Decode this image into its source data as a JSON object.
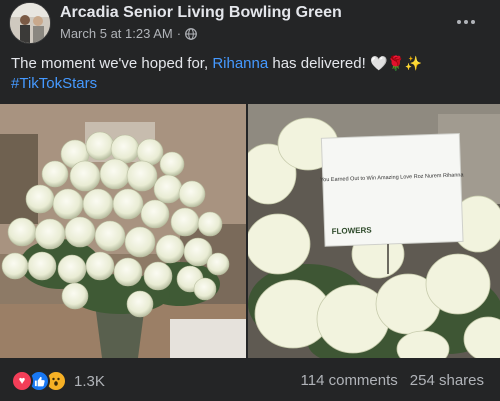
{
  "post": {
    "page_name": "Arcadia Senior Living Bowling Green",
    "timestamp": "March 5 at 1:23 AM",
    "separator": "·",
    "privacy_icon": "globe-icon",
    "menu_icon": "more-options-icon"
  },
  "caption": {
    "text_before": "The moment we've hoped for, ",
    "mention": "Rihanna",
    "text_after": " has delivered! ",
    "emojis": "🤍🌹✨",
    "hashtag": "#TikTokStars"
  },
  "photos": {
    "card_text": "You Earned Out to Win Amazing Love Roz Nurem Rihanna",
    "florist_label": "FLOWERS"
  },
  "engagement": {
    "reaction_icons": [
      "love-reaction-icon",
      "like-reaction-icon",
      "wow-reaction-icon"
    ],
    "reaction_count": "1.3K",
    "comments": "114 comments",
    "shares": "254 shares"
  },
  "colors": {
    "background": "#242526",
    "text": "#e4e6eb",
    "secondary_text": "#b0b3b8",
    "link": "#4599ff",
    "love": "#f33e58",
    "like": "#1877f2",
    "wow": "#f7b125"
  }
}
